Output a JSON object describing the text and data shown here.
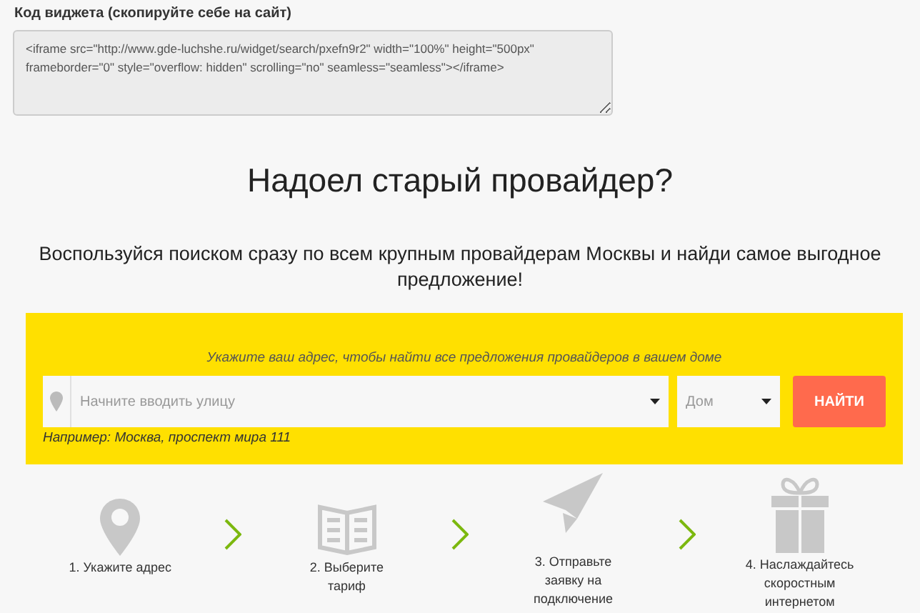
{
  "widget_code": {
    "label": "Код виджета (скопируйте себе на сайт)",
    "value": "<iframe src=\"http://www.gde-luchshe.ru/widget/search/pxefn9r2\" width=\"100%\" height=\"500px\" frameborder=\"0\" style=\"overflow: hidden\" scrolling=\"no\" seamless=\"seamless\"></iframe>"
  },
  "title": "Надоел старый провайдер?",
  "subtitle": "Воспользуйся поиском сразу по всем крупным провайдерам Москвы и найди самое выгодное предложение!",
  "search": {
    "hint": "Укажите ваш адрес, чтобы найти все предложения провайдеров в вашем доме",
    "street_placeholder": "Начните вводить улицу",
    "house_placeholder": "Дом",
    "button": "НАЙТИ",
    "example": "Например: Москва, проспект мира 111"
  },
  "steps": [
    {
      "kind": "pin",
      "label": "1. Укажите адрес"
    },
    {
      "kind": "book",
      "label": "2. Выберите тариф"
    },
    {
      "kind": "plane",
      "label": "3. Отправьте заявку на подключение"
    },
    {
      "kind": "gift",
      "label": "4. Наслаждайтесь скоростным интернетом"
    }
  ]
}
